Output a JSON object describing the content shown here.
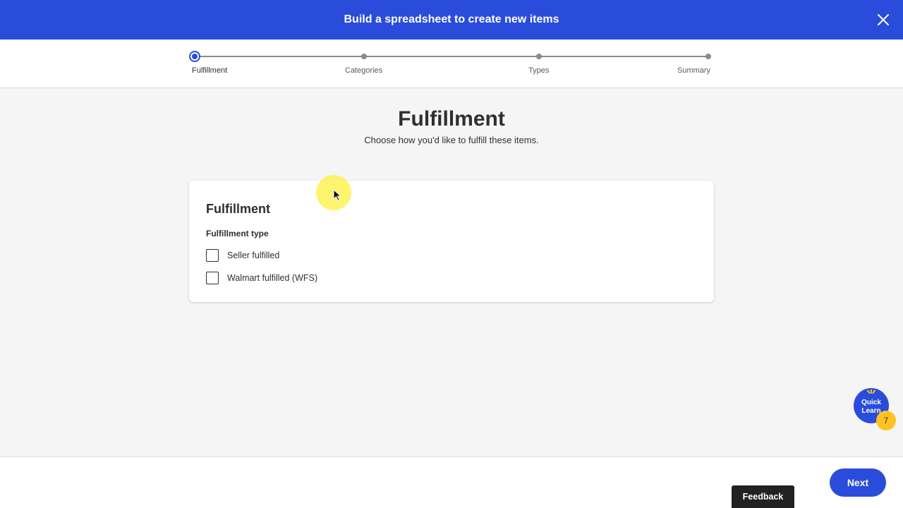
{
  "header": {
    "title": "Build a spreadsheet to create new items"
  },
  "stepper": {
    "steps": [
      {
        "label": "Fulfillment",
        "active": true
      },
      {
        "label": "Categories",
        "active": false
      },
      {
        "label": "Types",
        "active": false
      },
      {
        "label": "Summary",
        "active": false
      }
    ]
  },
  "main": {
    "title": "Fulfillment",
    "subtitle": "Choose how you'd like to fulfill these items."
  },
  "card": {
    "title": "Fulfillment",
    "section_label": "Fulfillment type",
    "options": [
      {
        "label": "Seller fulfilled",
        "checked": false
      },
      {
        "label": "Walmart fulfilled (WFS)",
        "checked": false
      }
    ]
  },
  "quick_learn": {
    "label": "Quick Learn",
    "badge_count": "7"
  },
  "footer": {
    "feedback_label": "Feedback",
    "next_label": "Next"
  },
  "colors": {
    "brand_blue": "#2a4cdb",
    "badge_yellow": "#ffc220"
  }
}
